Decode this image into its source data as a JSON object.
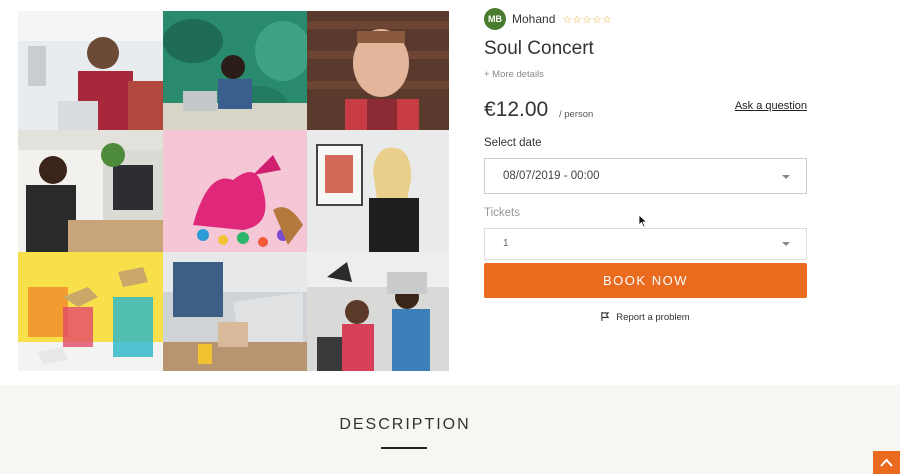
{
  "host": {
    "initials": "MB",
    "name": "Mohand",
    "stars": "☆☆☆☆☆"
  },
  "event": {
    "title": "Soul Concert",
    "more_details": "+ More details"
  },
  "pricing": {
    "price": "€12.00",
    "per": "/ person",
    "ask_link": "Ask a question"
  },
  "booking": {
    "date_label": "Select date",
    "date_value": "08/07/2019 - 00:00",
    "tickets_label": "Tickets",
    "tickets_value": "1",
    "book_label": "BOOK NOW",
    "report_label": "Report a problem"
  },
  "description": {
    "heading": "DESCRIPTION"
  },
  "gallery": {
    "tiles": [
      "office-workers-photo",
      "woman-laptop-leaf-wall-photo",
      "smiling-man-brick-wall-photo",
      "woman-at-computer-photo",
      "pink-dinosaur-toy-photo",
      "blonde-woman-portrait-photo",
      "gold-animal-toys-photo",
      "laptop-typing-photo",
      "group-meeting-photo"
    ]
  },
  "colors": {
    "accent": "#ea6a1e",
    "avatar": "#4a7c2f",
    "stars": "#e8b23a",
    "section_bg": "#f7f6f3"
  }
}
